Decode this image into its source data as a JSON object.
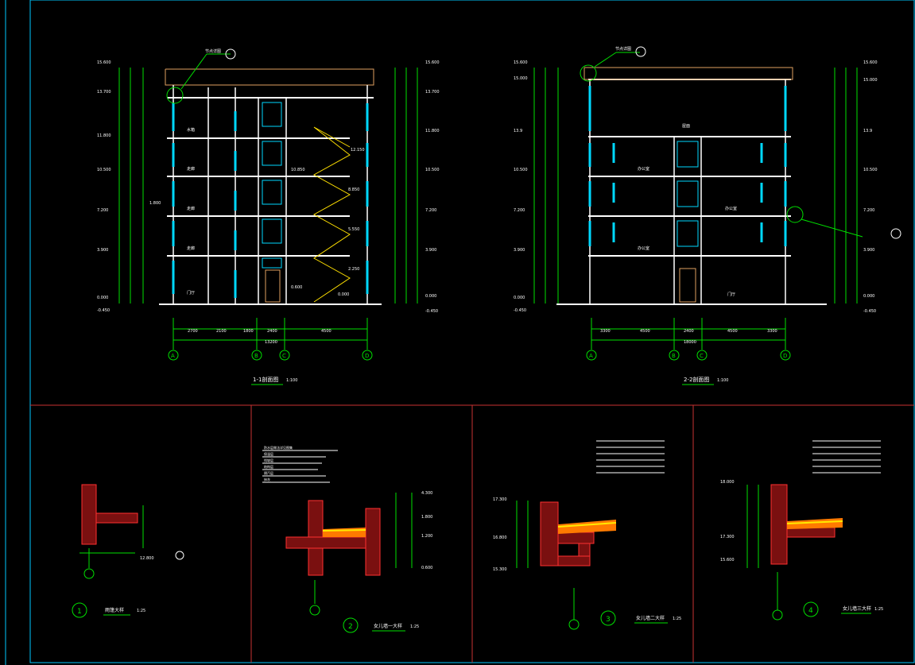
{
  "colors": {
    "background": "#000000",
    "frame": "#00c8ff",
    "panel_divider": "#c83232",
    "dimension": "#00e000",
    "wall": "#ffffff",
    "glass": "#00d8ff",
    "stair": "#ffe000",
    "hatch": "#c81818",
    "insulation": "#ffea00",
    "label": "#ffffff"
  },
  "section1": {
    "title": "1-1剖面图",
    "scale": "1:100",
    "elev_left": [
      "15.600",
      "13.700",
      "11.800",
      "10.500",
      "7.200",
      "3.900",
      "0.000",
      "-0.450"
    ],
    "elev_right": [
      "15.600",
      "13.700",
      "11.800",
      "10.500",
      "7.200",
      "3.900",
      "0.000",
      "-0.450"
    ],
    "stair_levels": [
      "12.150",
      "10.850",
      "8.850",
      "5.550",
      "2.250",
      "0.600",
      "0.000"
    ],
    "landing_label": "1.800",
    "room_labels": [
      "水箱",
      "走廊",
      "走廊",
      "走廊",
      "门厅"
    ],
    "wide_dims": [
      "2700",
      "2100",
      "1800",
      "2400",
      "4500"
    ],
    "total_dim": "13200",
    "axes": [
      "A",
      "B",
      "C",
      "D"
    ],
    "callout": "节点详图"
  },
  "section2": {
    "title": "2-2剖面图",
    "scale": "1:100",
    "elev_left": [
      "15.600",
      "15.000",
      "13.9",
      "10.500",
      "7.200",
      "3.900",
      "0.000",
      "-0.450"
    ],
    "elev_right": [
      "15.600",
      "15.000",
      "13.9",
      "10.500",
      "7.200",
      "3.900",
      "0.000",
      "-0.450"
    ],
    "room_labels": [
      "屋面",
      "办公室",
      "办公室",
      "办公室",
      "门厅"
    ],
    "wide_dims": [
      "3300",
      "4500",
      "2400",
      "4500",
      "3300"
    ],
    "total_dim": "18000",
    "axes": [
      "A",
      "B",
      "C",
      "D"
    ],
    "callout": "节点详图"
  },
  "details": [
    {
      "num": "1",
      "title": "雨篷大样",
      "scale": "1:25",
      "elev": "12.800"
    },
    {
      "num": "2",
      "title": "女儿墙一大样",
      "scale": "1:25",
      "elev_right": [
        "4.300",
        "1.800",
        "1.200",
        "0.600"
      ]
    },
    {
      "num": "3",
      "title": "女儿墙二大样",
      "scale": "1:25",
      "elev_left": [
        "17.300",
        "16.800",
        "15.300"
      ]
    },
    {
      "num": "4",
      "title": "女儿墙三大样",
      "scale": "1:25",
      "elev_left": [
        "18.000",
        "17.300",
        "15.600"
      ]
    }
  ],
  "note_lines": [
    "防水层做法详见图集",
    "保温层",
    "找坡层",
    "结构层",
    "隔汽层",
    "抹灰"
  ]
}
